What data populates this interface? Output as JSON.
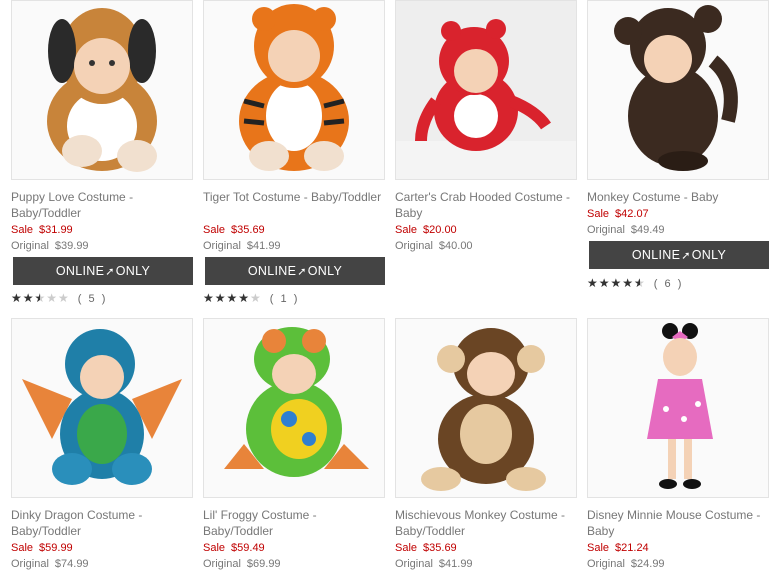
{
  "products": [
    {
      "title": "Puppy Love Costume - Baby/Toddler",
      "sale_label": "Sale",
      "sale_price": "$31.99",
      "orig_label": "Original",
      "orig_price": "$39.99",
      "badge": {
        "left": "ONLINE",
        "right": "ONLY"
      },
      "rating": 2.5,
      "rating_count": "( 5 )",
      "icon": "puppy-costume-photo",
      "colors": {
        "main": "#c8843a",
        "accent": "#ffffff",
        "hood": "#2a2a2a"
      }
    },
    {
      "title": "Tiger Tot Costume - Baby/Toddler",
      "sale_label": "Sale",
      "sale_price": "$35.69",
      "orig_label": "Original",
      "orig_price": "$41.99",
      "badge": {
        "left": "ONLINE",
        "right": "ONLY"
      },
      "rating": 4,
      "rating_count": "( 1 )",
      "icon": "tiger-costume-photo",
      "colors": {
        "main": "#e8751a",
        "accent": "#ffffff",
        "hood": "#e8751a"
      }
    },
    {
      "title": "Carter's Crab Hooded Costume - Baby",
      "sale_label": "Sale",
      "sale_price": "$20.00",
      "orig_label": "Original",
      "orig_price": "$40.00",
      "icon": "crab-costume-photo",
      "colors": {
        "main": "#d9232d",
        "accent": "#ffffff",
        "hood": "#d9232d"
      }
    },
    {
      "title": "Monkey Costume - Baby",
      "sale_label": "Sale",
      "sale_price": "$42.07",
      "orig_label": "Original",
      "orig_price": "$49.49",
      "badge": {
        "left": "ONLINE",
        "right": "ONLY"
      },
      "rating": 4.5,
      "rating_count": "( 6 )",
      "icon": "monkey-costume-photo",
      "colors": {
        "main": "#3b2a20",
        "accent": "#3b2a20",
        "hood": "#3b2a20"
      }
    },
    {
      "title": "Dinky Dragon Costume - Baby/Toddler",
      "sale_label": "Sale",
      "sale_price": "$59.99",
      "orig_label": "Original",
      "orig_price": "$74.99",
      "icon": "dragon-costume-photo",
      "colors": {
        "main": "#1f7fa8",
        "accent": "#3aa84a",
        "hood": "#1f7fa8"
      }
    },
    {
      "title": "Lil' Froggy Costume - Baby/Toddler",
      "sale_label": "Sale",
      "sale_price": "$59.49",
      "orig_label": "Original",
      "orig_price": "$69.99",
      "icon": "frog-costume-photo",
      "colors": {
        "main": "#5cbf3a",
        "accent": "#2f7fd0",
        "hood": "#5cbf3a"
      }
    },
    {
      "title": "Mischievous Monkey Costume - Baby/Toddler",
      "sale_label": "Sale",
      "sale_price": "$35.69",
      "orig_label": "Original",
      "orig_price": "$41.99",
      "icon": "monkey-costume-photo",
      "colors": {
        "main": "#6a4524",
        "accent": "#e6c9a0",
        "hood": "#6a4524"
      }
    },
    {
      "title": "Disney Minnie Mouse Costume - Baby",
      "sale_label": "Sale",
      "sale_price": "$21.24",
      "orig_label": "Original",
      "orig_price": "$24.99",
      "icon": "minnie-costume-photo",
      "colors": {
        "main": "#e66bc0",
        "accent": "#ffffff",
        "hood": "#111111"
      }
    }
  ]
}
